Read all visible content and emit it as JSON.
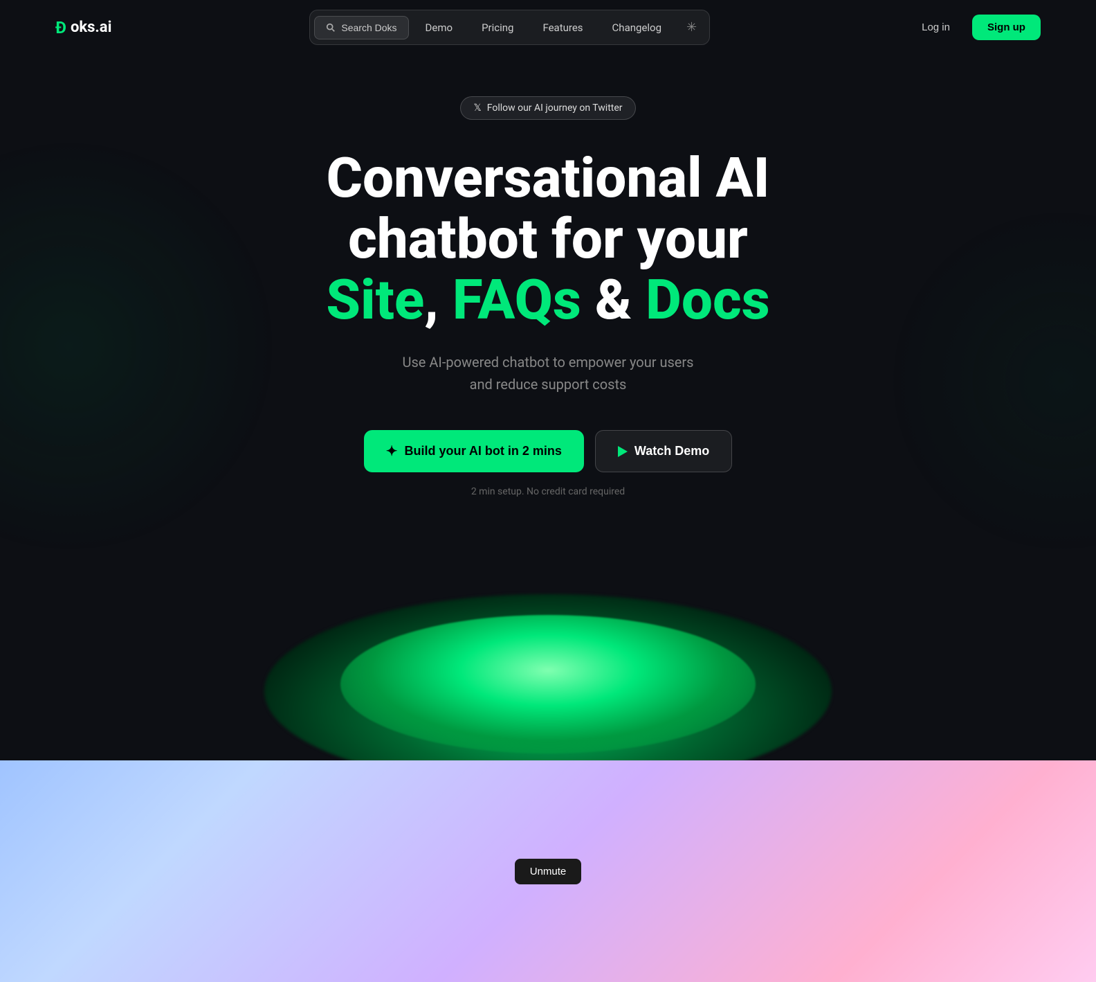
{
  "logo": {
    "icon": "Ð",
    "text": "oks.ai",
    "full": "Ðoks.ai"
  },
  "navbar": {
    "search_label": "Search Doks",
    "links": [
      {
        "label": "Demo",
        "id": "demo"
      },
      {
        "label": "Pricing",
        "id": "pricing"
      },
      {
        "label": "Features",
        "id": "features"
      },
      {
        "label": "Changelog",
        "id": "changelog"
      }
    ],
    "login_label": "Log in",
    "signup_label": "Sign up"
  },
  "hero": {
    "twitter_badge": "Follow our AI journey on Twitter",
    "title_line1": "Conversational AI",
    "title_line2": "chatbot for your",
    "title_green1": "Site",
    "title_separator1": ", ",
    "title_green2": "FAQs",
    "title_separator2": " & ",
    "title_green3": "Docs",
    "subtitle_line1": "Use AI-powered chatbot to empower your users",
    "subtitle_line2": "and reduce support costs",
    "cta_primary": "Build your AI bot in 2 mins",
    "cta_secondary": "Watch Demo",
    "setup_note": "2 min setup. No credit card required"
  },
  "video": {
    "unmute_label": "Unmute"
  },
  "colors": {
    "green": "#00e87a",
    "dark_bg": "#0d0f14",
    "nav_bg": "rgba(255,255,255,0.06)"
  }
}
